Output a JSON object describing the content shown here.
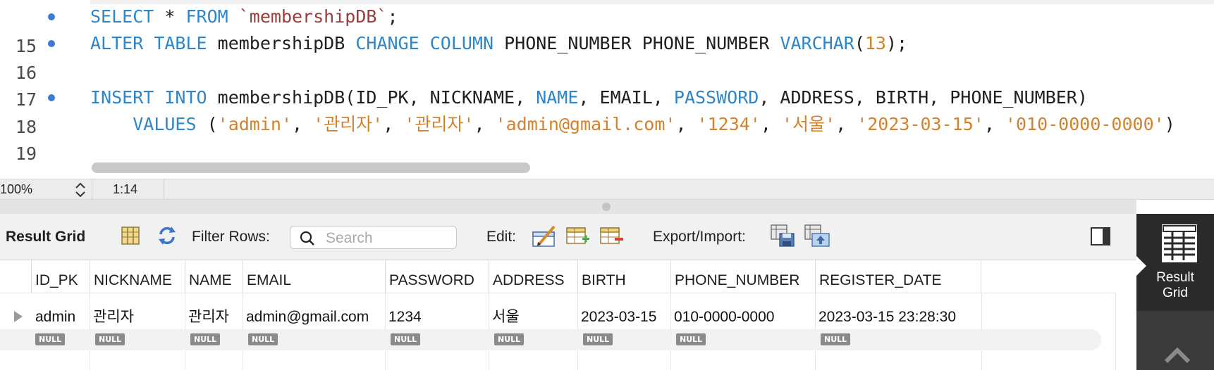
{
  "editor": {
    "lines": [
      {
        "num": "15",
        "marker": true
      },
      {
        "num": "16",
        "marker": true
      },
      {
        "num": "17",
        "marker": false
      },
      {
        "num": "18",
        "marker": true
      },
      {
        "num": "19",
        "marker": false
      }
    ],
    "tokens": {
      "select": "SELECT",
      "star": " * ",
      "from": "FROM",
      "table_q": "`membershipDB`",
      "semi": ";",
      "alter": "ALTER",
      "table": "TABLE",
      "tbl": "membershipDB",
      "change": "CHANGE",
      "column": "COLUMN",
      "col_names": "PHONE_NUMBER PHONE_NUMBER",
      "varchar": "VARCHAR",
      "open_paren": "(",
      "size": "13",
      "close_semi": ");",
      "insert": "INSERT",
      "into": "INTO",
      "tbl_open": "membershipDB(ID_PK, NICKNAME, ",
      "name_kw": "NAME",
      "email_part": ", EMAIL, ",
      "password_kw": "PASSWORD",
      "rest_cols": ", ADDRESS, BIRTH, PHONE_NUMBER)",
      "values_kw": "VALUES",
      "v1": "'admin'",
      "v2": "'관리자'",
      "v3": "'관리자'",
      "v4": "'admin@gmail.com'",
      "v5": "'1234'",
      "v6": "'서울'",
      "v7": "'2023-03-15'",
      "v8": "'010-0000-0000'",
      "close_paren": ")",
      "comma": ", "
    }
  },
  "statusbar": {
    "zoom": "100%",
    "cursor_pos": "1:14"
  },
  "toolbar": {
    "title": "Result Grid",
    "filter_label": "Filter Rows:",
    "search_placeholder": "Search",
    "edit_label": "Edit:",
    "export_label": "Export/Import:"
  },
  "grid": {
    "columns": [
      "ID_PK",
      "NICKNAME",
      "NAME",
      "EMAIL",
      "PASSWORD",
      "ADDRESS",
      "BIRTH",
      "PHONE_NUMBER",
      "REGISTER_DATE"
    ],
    "row": [
      "admin",
      "관리자",
      "관리자",
      "admin@gmail.com",
      "1234",
      "서울",
      "2023-03-15",
      "010-0000-0000",
      "2023-03-15 23:28:30"
    ],
    "null_label": "NULL"
  },
  "sidepanel": {
    "label_line1": "Result",
    "label_line2": "Grid"
  },
  "colors": {
    "keyword": "#2e86c9",
    "string": "#d4812b",
    "backtick": "#9b3c3c",
    "marker": "#3e79d6"
  }
}
